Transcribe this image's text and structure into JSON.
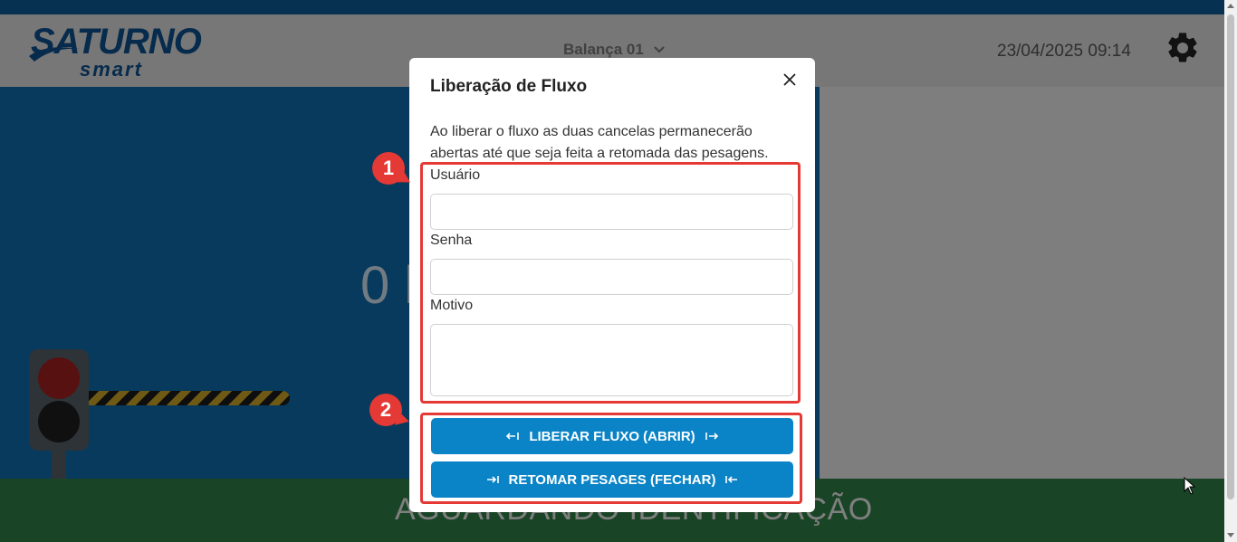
{
  "header": {
    "brand_main": "SATURNO",
    "brand_sub": "smart",
    "scale_selector": "Balança 01",
    "datetime": "23/04/2025 09:14"
  },
  "main": {
    "weight_display": "0 k",
    "status_message": "AGUARDANDO IDENTIFICAÇÃO",
    "traffic_light_state": "red",
    "colors": {
      "panel": "#0d6aa8",
      "status_bar": "#2e7d44"
    }
  },
  "modal": {
    "title": "Liberação de Fluxo",
    "description": "Ao liberar o fluxo as duas cancelas permanecerão abertas até que seja feita a retomada das pesagens.",
    "fields": {
      "user_label": "Usuário",
      "password_label": "Senha",
      "reason_label": "Motivo"
    },
    "buttons": {
      "release_label": "LIBERAR FLUXO (ABRIR)",
      "resume_label": "RETOMAR PESAGES (FECHAR)"
    },
    "accent_color": "#0a84c6"
  },
  "annotations": {
    "badge_1": "1",
    "badge_2": "2",
    "color": "#e53935"
  }
}
